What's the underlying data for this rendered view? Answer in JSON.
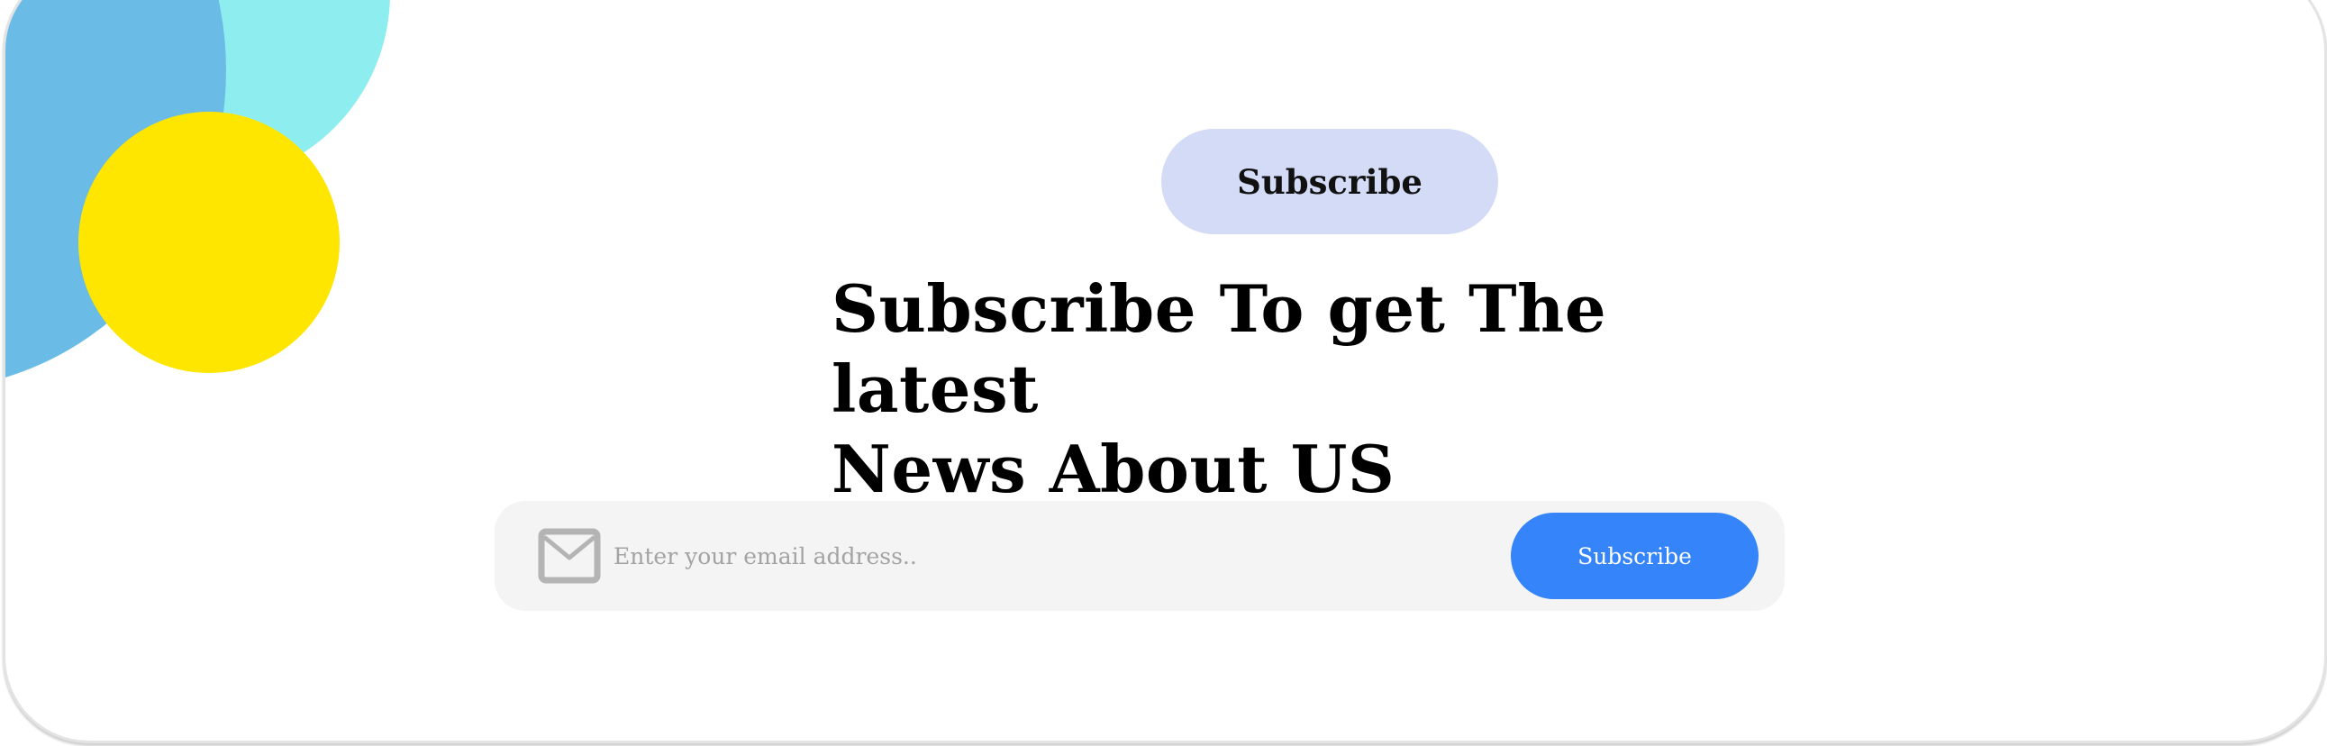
{
  "decor": {
    "colors": {
      "cyan": "#8eedee",
      "blue": "#6abce6",
      "yellow": "#fee600"
    }
  },
  "badge": {
    "label": "Subscribe",
    "color": "#d3dbf6"
  },
  "headline": {
    "line1": "Subscribe To get The latest",
    "line2": "News About US"
  },
  "form": {
    "icon": "mail-icon",
    "email_placeholder": "Enter your email address..",
    "email_value": "",
    "submit_label": "Subscribe",
    "submit_color": "#3584f9"
  }
}
